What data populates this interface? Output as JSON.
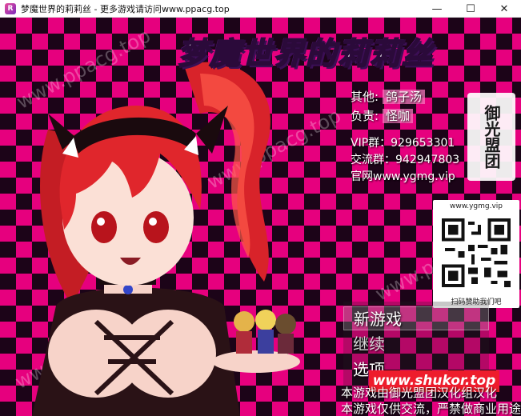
{
  "window": {
    "title": "梦魔世界的莉莉丝 - 更多游戏请访问www.ppacg.top",
    "min_glyph": "—",
    "max_glyph": "☐",
    "close_glyph": "✕"
  },
  "title_screen": {
    "logo": "梦魔世界的莉莉丝",
    "credits": {
      "other_label": "其他:",
      "other_value": "鸽子汤",
      "lead_label": "负责:",
      "lead_value": "怪咖",
      "vip": "VIP群：929653301",
      "exchange": "交流群：942947803",
      "site": "官网www.ygmg.vip"
    },
    "seal_text": "御光盟团",
    "qr": {
      "url": "www.ygmg.vip",
      "caption": "扫码赞助我们吧"
    },
    "menu": {
      "new_game": "新游戏",
      "continue": "继续",
      "options": "选项"
    },
    "banner": "www.shukor.top",
    "notice_1": "本游戏由御光盟团汉化组汉化",
    "notice_2": "本游戏仅供交流，严禁做商业用途",
    "watermark": "www.ppacg.top"
  },
  "colors": {
    "checker_pink": "#e6007e",
    "checker_dark": "#1c0418",
    "banner_red": "#ee1c2c",
    "hair_red": "#e0262c"
  }
}
